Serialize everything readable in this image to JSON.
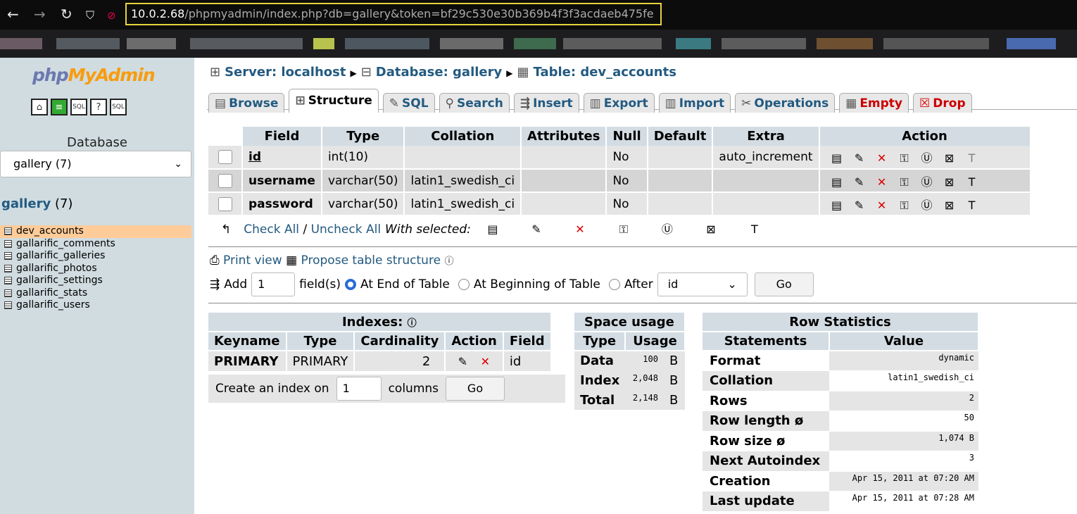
{
  "browser": {
    "back": "←",
    "forward": "→",
    "reload": "↻",
    "shield": "⛉",
    "url_host": "10.0.2.68",
    "url_rest": "/phpmyadmin/index.php?db=gallery&token=bf29c530e30b369b4f3f3acdaeb475fe"
  },
  "sidebar": {
    "logo_php": "php",
    "logo_my": "My",
    "logo_admin": "Admin",
    "nav_icons": [
      "home-icon",
      "query-icon",
      "sql-window-icon",
      "docs-icon",
      "sql-docs-icon"
    ],
    "db_label": "Database",
    "db_select": "gallery (7)",
    "db_title": "gallery",
    "db_count": "(7)",
    "tables": [
      {
        "name": "dev_accounts"
      },
      {
        "name": "gallarific_comments"
      },
      {
        "name": "gallarific_galleries"
      },
      {
        "name": "gallarific_photos"
      },
      {
        "name": "gallarific_settings"
      },
      {
        "name": "gallarific_stats"
      },
      {
        "name": "gallarific_users"
      }
    ]
  },
  "breadcrumb": {
    "server": "Server: localhost",
    "database": "Database: gallery",
    "table": "Table: dev_accounts"
  },
  "tabs": [
    {
      "label": "Browse"
    },
    {
      "label": "Structure"
    },
    {
      "label": "SQL"
    },
    {
      "label": "Search"
    },
    {
      "label": "Insert"
    },
    {
      "label": "Export"
    },
    {
      "label": "Import"
    },
    {
      "label": "Operations"
    },
    {
      "label": "Empty"
    },
    {
      "label": "Drop"
    }
  ],
  "fields_table": {
    "headers": [
      "Field",
      "Type",
      "Collation",
      "Attributes",
      "Null",
      "Default",
      "Extra",
      "Action"
    ],
    "rows": [
      {
        "field": "id",
        "type": "int(10)",
        "collation": "",
        "attributes": "",
        "null": "No",
        "default": "",
        "extra": "auto_increment"
      },
      {
        "field": "username",
        "type": "varchar(50)",
        "collation": "latin1_swedish_ci",
        "attributes": "",
        "null": "No",
        "default": "",
        "extra": ""
      },
      {
        "field": "password",
        "type": "varchar(50)",
        "collation": "latin1_swedish_ci",
        "attributes": "",
        "null": "No",
        "default": "",
        "extra": ""
      }
    ]
  },
  "bulk": {
    "check_all": "Check All",
    "separator": "/",
    "uncheck_all": "Uncheck All",
    "with_selected": "With selected:"
  },
  "links": {
    "print_view": "Print view",
    "propose": "Propose table structure"
  },
  "add_fields": {
    "add": "Add",
    "count": "1",
    "fields_label": "field(s)",
    "at_end": "At End of Table",
    "at_beginning": "At Beginning of Table",
    "after": "After",
    "after_field": "id",
    "go": "Go"
  },
  "indexes": {
    "title": "Indexes:",
    "headers": [
      "Keyname",
      "Type",
      "Cardinality",
      "Action",
      "Field"
    ],
    "rows": [
      {
        "keyname": "PRIMARY",
        "type": "PRIMARY",
        "cardinality": "2",
        "field": "id"
      }
    ],
    "create_label": "Create an index on",
    "create_count": "1",
    "columns": "columns",
    "go": "Go"
  },
  "space": {
    "title": "Space usage",
    "headers": [
      "Type",
      "Usage"
    ],
    "rows": [
      {
        "type": "Data",
        "value": "100",
        "unit": "B"
      },
      {
        "type": "Index",
        "value": "2,048",
        "unit": "B"
      },
      {
        "type": "Total",
        "value": "2,148",
        "unit": "B"
      }
    ]
  },
  "row_stats": {
    "title": "Row Statistics",
    "headers": [
      "Statements",
      "Value"
    ],
    "rows": [
      {
        "label": "Format",
        "value": "dynamic"
      },
      {
        "label": "Collation",
        "value": "latin1_swedish_ci"
      },
      {
        "label": "Rows",
        "value": "2"
      },
      {
        "label": "Row length ø",
        "value": "50"
      },
      {
        "label": "Row size ø",
        "value": "1,074 B"
      },
      {
        "label": "Next Autoindex",
        "value": "3"
      },
      {
        "label": "Creation",
        "value": "Apr 15, 2011 at 07:20 AM"
      },
      {
        "label": "Last update",
        "value": "Apr 15, 2011 at 07:28 AM"
      }
    ]
  },
  "colors": {
    "link": "#235a81",
    "header_bg": "#d3dce3",
    "sidebar_bg": "#d0dce0",
    "active_row": "#ffcc99",
    "delete_red": "#d00"
  }
}
